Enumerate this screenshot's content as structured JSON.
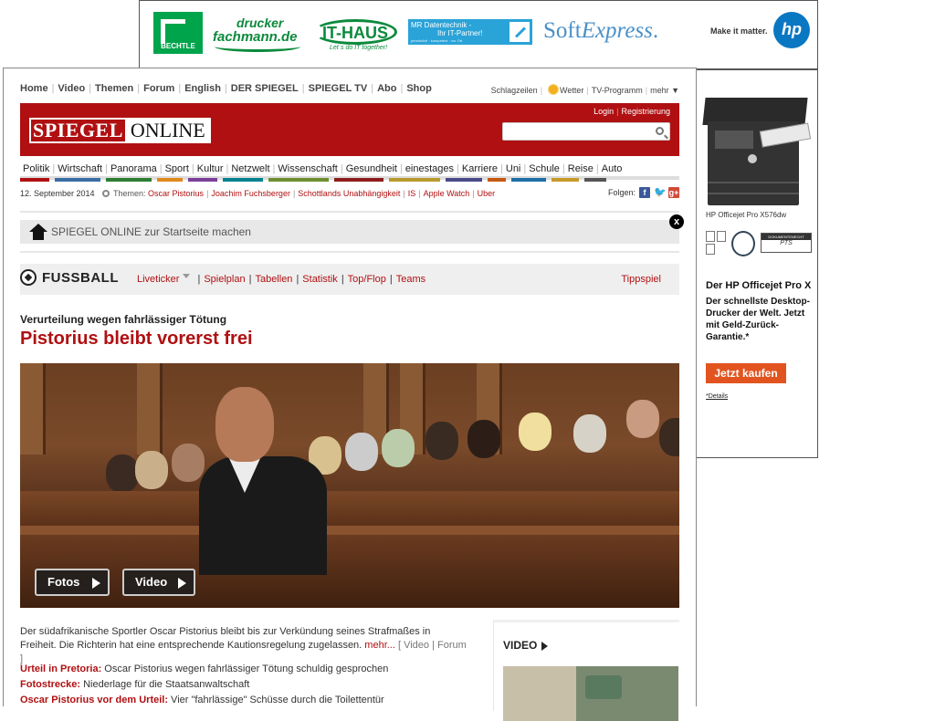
{
  "top_ad": {
    "bechtle": "BECHTLE",
    "drucker_1": "drucker",
    "drucker_2": "fachmann.de",
    "ithaus_1": "IT-HAUS",
    "ithaus_2": "Let´s do IT together!",
    "mr_1": "MR Datentechnik -",
    "mr_2": "Ihr IT-Partner!",
    "mr_3": "persönlich · kompetent · vor Ort",
    "softexpress_a": "Soft",
    "softexpress_b": "Express",
    "softexpress_c": ".",
    "makeit": "Make it matter.",
    "hp": "hp"
  },
  "right_ad": {
    "model": "HP Officejet Pro X576dw",
    "badge_text": "DOKUMENTENECHT",
    "badge_sub": "PTS",
    "headline": "Der HP Officejet Pro X",
    "sub": "Der schnellste Desktop-Drucker der Welt. Jetzt mit Geld-Zurück-Garantie.*",
    "cta": "Jetzt kaufen",
    "details": "*Details"
  },
  "topnav": {
    "left": [
      "Home",
      "Video",
      "Themen",
      "Forum",
      "English",
      "DER SPIEGEL",
      "SPIEGEL TV",
      "Abo",
      "Shop"
    ],
    "schlagzeilen": "Schlagzeilen",
    "wetter": "Wetter",
    "tv": "TV-Programm",
    "mehr": "mehr ▼"
  },
  "masthead": {
    "logo_a": "SPIEGEL",
    "logo_b": "ONLINE",
    "login": "Login",
    "register": "Registrierung",
    "search_placeholder": ""
  },
  "catnav": [
    "Politik",
    "Wirtschaft",
    "Panorama",
    "Sport",
    "Kultur",
    "Netzwelt",
    "Wissenschaft",
    "Gesundheit",
    "einestages",
    "Karriere",
    "Uni",
    "Schule",
    "Reise",
    "Auto"
  ],
  "catnav_colors": [
    "#b01012",
    "#3a6ea5",
    "#2e7d32",
    "#e08a1e",
    "#7b3f99",
    "#00838f",
    "#6d8f2f",
    "#8e1c1c",
    "#b89b2c",
    "#4a4a8a",
    "#c55a11",
    "#1e6fa5",
    "#c79a2a",
    "#555555"
  ],
  "meta": {
    "date": "12. September 2014",
    "themen_label": "Themen:",
    "themen": [
      "Oscar Pistorius",
      "Joachim Fuchsberger",
      "Schottlands Unabhängigkeit",
      "IS",
      "Apple Watch",
      "Uber"
    ],
    "folgen": "Folgen:"
  },
  "home_bar": {
    "label": "SPIEGEL ONLINE zur Startseite machen",
    "close": "x"
  },
  "fussball": {
    "title": "FUSSBALL",
    "links": [
      "Liveticker",
      "Spielplan",
      "Tabellen",
      "Statistik",
      "Top/Flop",
      "Teams"
    ],
    "tipp": "Tippspiel"
  },
  "article": {
    "kicker": "Verurteilung wegen fahrlässiger Tötung",
    "headline": "Pistorius bleibt vorerst frei",
    "btn_fotos": "Fotos",
    "btn_video": "Video",
    "teaser": "Der südafrikanische Sportler Oscar Pistorius bleibt bis zur Verkündung seines Strafmaßes in Freiheit. Die Richterin hat eine entsprechende Kautionsregelung zugelassen.",
    "more": "mehr...",
    "bracket": "[ Video | Forum ]",
    "related": [
      {
        "label": "Urteil in Pretoria:",
        "text": " Oscar Pistorius wegen fahrlässiger Tötung schuldig gesprochen"
      },
      {
        "label": "Fotostrecke:",
        "text": " Niederlage für die Staatsanwaltschaft"
      },
      {
        "label": "Oscar Pistorius vor dem Urteil:",
        "text": " Vier \"fahrlässige\" Schüsse durch die Toilettentür"
      }
    ]
  },
  "video_col": {
    "title": "VIDEO"
  }
}
